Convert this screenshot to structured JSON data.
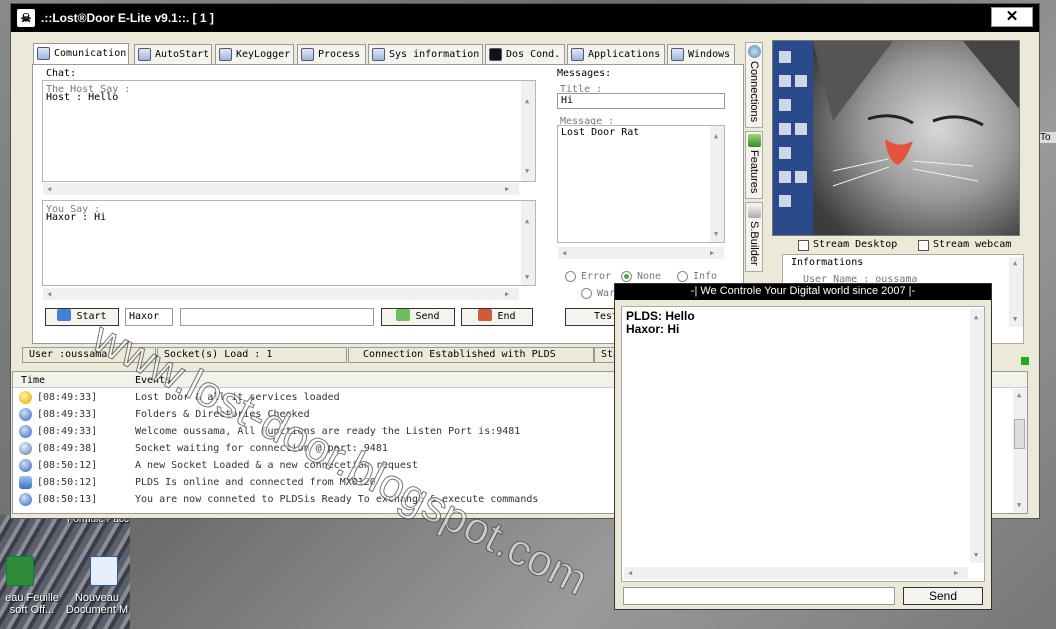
{
  "window": {
    "title": ".::Lost®Door E-Lite v9.1::.  [ 1 ]",
    "close_glyph": "✕"
  },
  "tabs": [
    {
      "label": "Comunication",
      "active": true
    },
    {
      "label": "AutoStart"
    },
    {
      "label": "KeyLogger"
    },
    {
      "label": "Process"
    },
    {
      "label": "Sys information"
    },
    {
      "label": "Dos Cond."
    },
    {
      "label": "Applications"
    },
    {
      "label": "Windows"
    }
  ],
  "chat": {
    "label": "Chat:",
    "host_say_label": "The Host Say :",
    "host_say_text": "Host : Hello",
    "you_say_label": "You Say :",
    "you_say_text": "Haxor : Hi",
    "start_label": "Start",
    "nick_value": "Haxor",
    "message_value": "",
    "send_label": "Send",
    "end_label": "End"
  },
  "messages": {
    "label": "Messages:",
    "title_label": "Title :",
    "title_value": "Hi",
    "message_label": "Message :",
    "message_value": "Lost Door Rat",
    "radios": [
      {
        "label": "Error",
        "selected": false
      },
      {
        "label": "None",
        "selected": true
      },
      {
        "label": "Info",
        "selected": false
      },
      {
        "label": "War",
        "selected": false
      }
    ],
    "test_label": "Test"
  },
  "side_tabs": [
    {
      "label": "Connections"
    },
    {
      "label": "Features"
    },
    {
      "label": "S.Builder"
    }
  ],
  "webcam": {
    "stream_desktop": "Stream Desktop",
    "stream_webcam": "Stream webcam"
  },
  "informations": {
    "title": "Informations",
    "user_name": "User Name : oussama"
  },
  "status": {
    "user": "User :oussama",
    "sockets": "Socket(s) Load : 1",
    "connection": "Connection Established with PLDS",
    "extra": "Sta"
  },
  "events": {
    "col_time": "Time",
    "col_events": "Events",
    "rows": [
      {
        "time": "[08:49:33]",
        "text": "Lost Door & all it services loaded",
        "icon": "smile-icon"
      },
      {
        "time": "[08:49:33]",
        "text": "Folders & Directories Checked",
        "icon": "info-icon"
      },
      {
        "time": "[08:49:33]",
        "text": "Welcome oussama, All Functions are ready the Listen Port is:9481",
        "icon": "info-icon"
      },
      {
        "time": "[08:49:38]",
        "text": "Socket waiting for connection @ port: 9481",
        "icon": "signal-icon"
      },
      {
        "time": "[08:50:12]",
        "text": "A new Socket Loaded & a new connecetion request",
        "icon": "info-icon"
      },
      {
        "time": "[08:50:12]",
        "text": "PLDS Is online and connected from MX0120",
        "icon": "user-icon"
      },
      {
        "time": "[08:50:13]",
        "text": "You are now conneted to PLDSis Ready To exchange & execute commands",
        "icon": "info-icon"
      }
    ]
  },
  "chat_popup": {
    "title": "-| We Controle Your Digital  world since 2007 |-",
    "lines": [
      "PLDS: Hello",
      "Haxor: Hi"
    ],
    "input_value": "",
    "send_label": "Send"
  },
  "desktop": {
    "icon1_label": "eau Feuille\nsoft Off...",
    "icon2_label": "Nouveau\nDocument M",
    "top_label": "Formule Pacc",
    "edge_label": "To"
  },
  "watermark": "www.lost-door.blogspot.com",
  "colors": {
    "titlebar": "#000000",
    "window_bg": "#ece9d8",
    "radio_selected": "#44aa55"
  }
}
